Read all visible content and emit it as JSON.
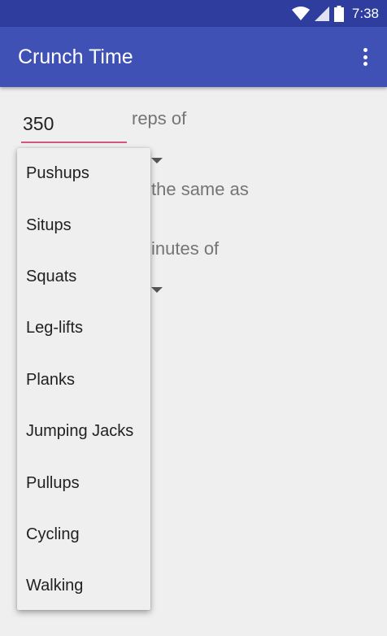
{
  "status_bar": {
    "time": "7:38",
    "icons": [
      "wifi-icon",
      "cell-signal-icon",
      "battery-icon"
    ],
    "background": "#2F3E9E"
  },
  "app_bar": {
    "title": "Crunch Time",
    "overflow_icon": "more-vert-icon",
    "background": "#3F51B5"
  },
  "form": {
    "reps_value": "350",
    "reps_label": "reps of",
    "same_as_label": "the same as",
    "minutes_label": "inutes of",
    "underline_color": "#D2577F"
  },
  "dropdown": {
    "options": [
      "Pushups",
      "Situps",
      "Squats",
      "Leg-lifts",
      "Planks",
      "Jumping Jacks",
      "Pullups",
      "Cycling",
      "Walking"
    ]
  }
}
